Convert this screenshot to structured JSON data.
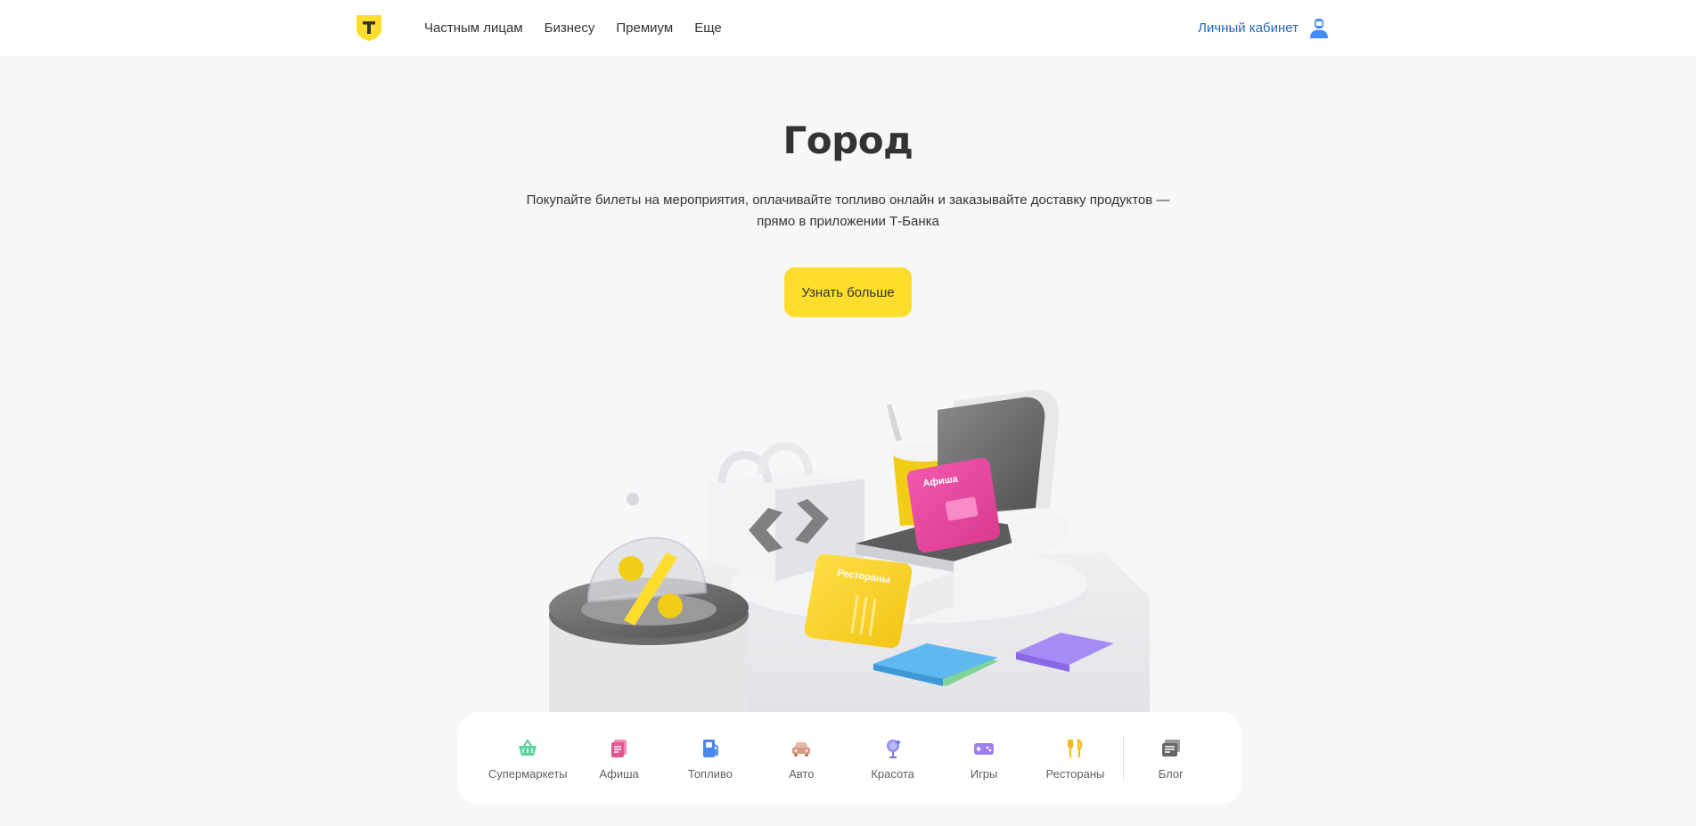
{
  "header": {
    "nav": [
      {
        "label": "Частным лицам"
      },
      {
        "label": "Бизнесу"
      },
      {
        "label": "Премиум"
      },
      {
        "label": "Еще"
      }
    ],
    "account_label": "Личный кабинет"
  },
  "hero": {
    "title": "Город",
    "description_line1": "Покупайте билеты на мероприятия, оплачивайте топливо онлайн и заказывайте доставку продуктов —",
    "description_line2": "прямо в приложении Т-Банка",
    "cta_label": "Узнать больше"
  },
  "illustration": {
    "badge_afisha": "Афиша",
    "badge_restaurants": "Рестораны"
  },
  "services": [
    {
      "label": "Супермаркеты",
      "icon": "basket-icon"
    },
    {
      "label": "Афиша",
      "icon": "ticket-icon"
    },
    {
      "label": "Топливо",
      "icon": "fuel-icon"
    },
    {
      "label": "Авто",
      "icon": "car-icon"
    },
    {
      "label": "Красота",
      "icon": "mirror-icon"
    },
    {
      "label": "Игры",
      "icon": "gamepad-icon"
    },
    {
      "label": "Рестораны",
      "icon": "fork-knife-icon"
    }
  ],
  "blog": {
    "label": "Блог",
    "icon": "blog-icon"
  },
  "colors": {
    "accent_yellow": "#ffdd2d",
    "link_blue": "#2767b4",
    "page_bg": "#f6f7f8"
  }
}
